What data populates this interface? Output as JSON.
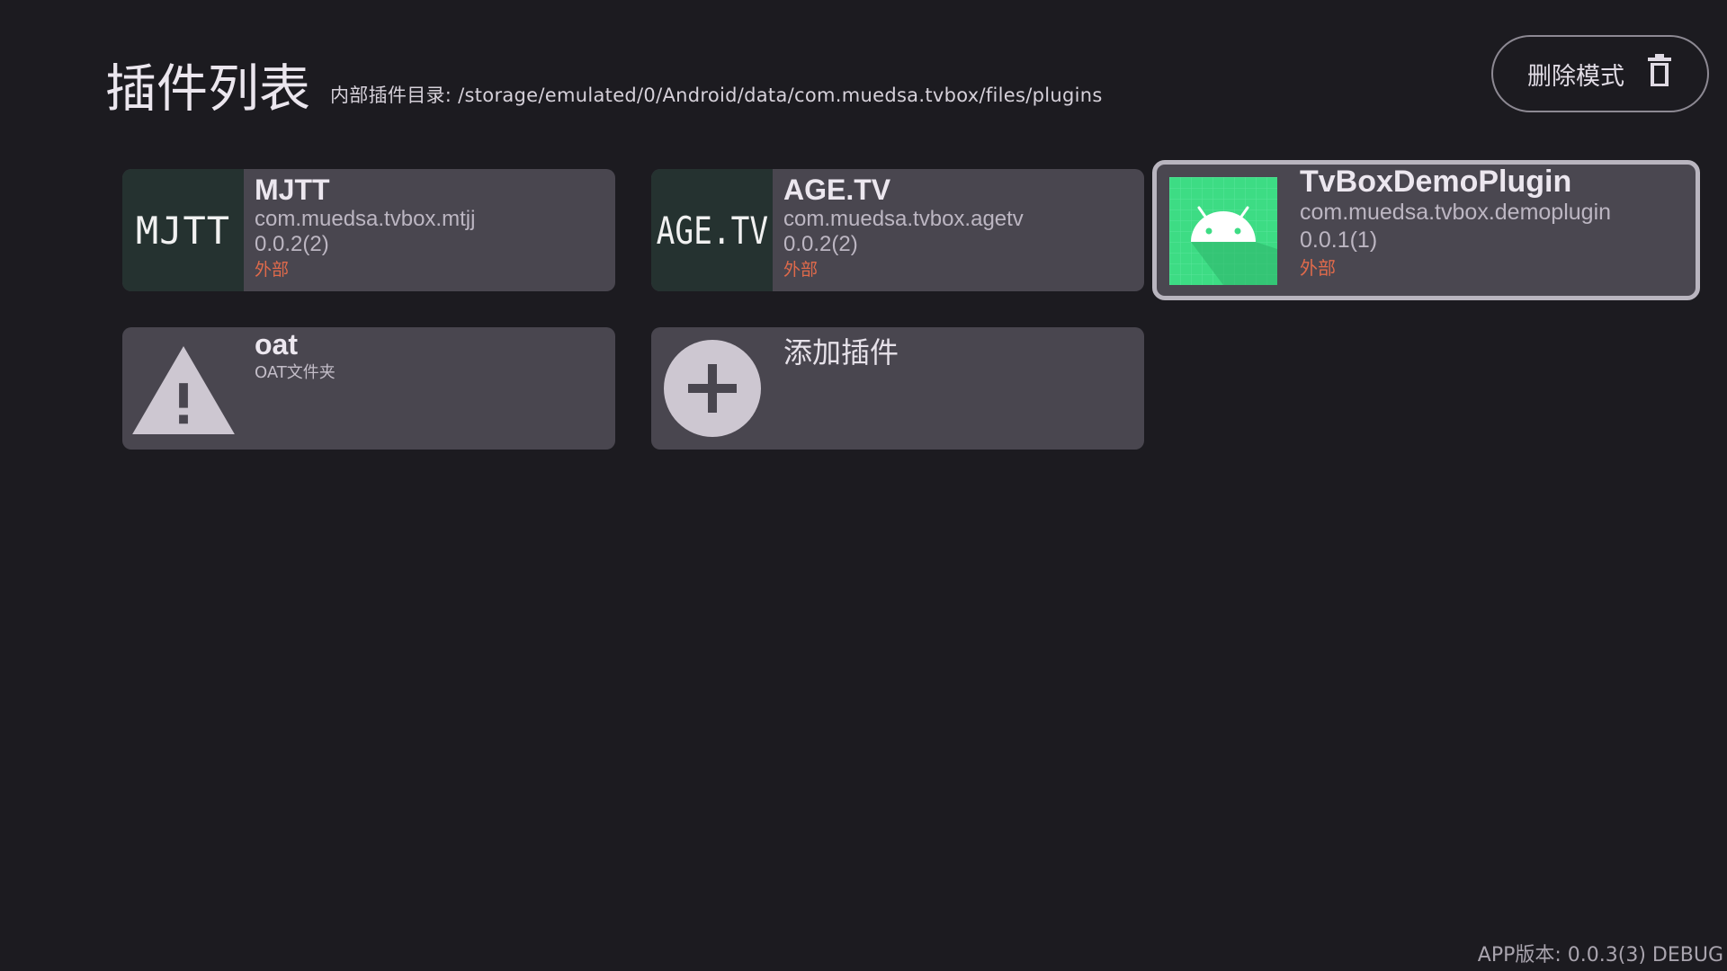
{
  "header": {
    "title": "插件列表",
    "path": "内部插件目录: /storage/emulated/0/Android/data/com.muedsa.tvbox/files/plugins"
  },
  "delete_button": {
    "label": "删除模式",
    "icon": "trash-icon"
  },
  "plugins": [
    {
      "icon_text": "MJTT",
      "name": "MJTT",
      "package": "com.muedsa.tvbox.mtjj",
      "version": "0.0.2(2)",
      "source": "外部"
    },
    {
      "icon_text": "AGE.TV",
      "name": "AGE.TV",
      "package": "com.muedsa.tvbox.agetv",
      "version": "0.0.2(2)",
      "source": "外部"
    },
    {
      "icon": "android-icon",
      "name": "TvBoxDemoPlugin",
      "package": "com.muedsa.tvbox.demoplugin",
      "version": "0.0.1(1)",
      "source": "外部"
    }
  ],
  "oat": {
    "icon": "warning-icon",
    "name": "oat",
    "subtitle": "OAT文件夹"
  },
  "add_plugin": {
    "icon": "plus-circle-icon",
    "label": "添加插件"
  },
  "footer": {
    "version": "APP版本: 0.0.3(3) DEBUG"
  },
  "colors": {
    "background": "#1c1b20",
    "card": "#49464f",
    "external_tag": "#e06a4b",
    "android_green": "#3ddc84"
  }
}
